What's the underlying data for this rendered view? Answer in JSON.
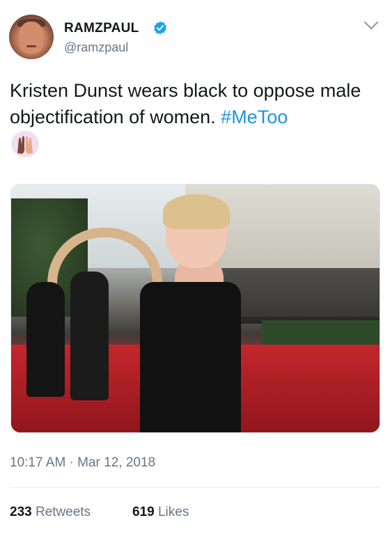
{
  "tweet": {
    "display_name": "RAMZPAUL",
    "handle": "@ramzpaul",
    "verified": true,
    "text_main": "Kristen Dunst wears black to oppose male objectification of women.",
    "hashtag": "#MeToo",
    "emoji_icon": "raised-hands-icon",
    "timestamp": "10:17 AM · Mar 12, 2018",
    "retweets_count": "233",
    "retweets_label": "Retweets",
    "likes_count": "619",
    "likes_label": "Likes"
  },
  "colors": {
    "link": "#1b95e0",
    "verified_badge": "#1da1f2",
    "secondary_text": "#657786"
  }
}
